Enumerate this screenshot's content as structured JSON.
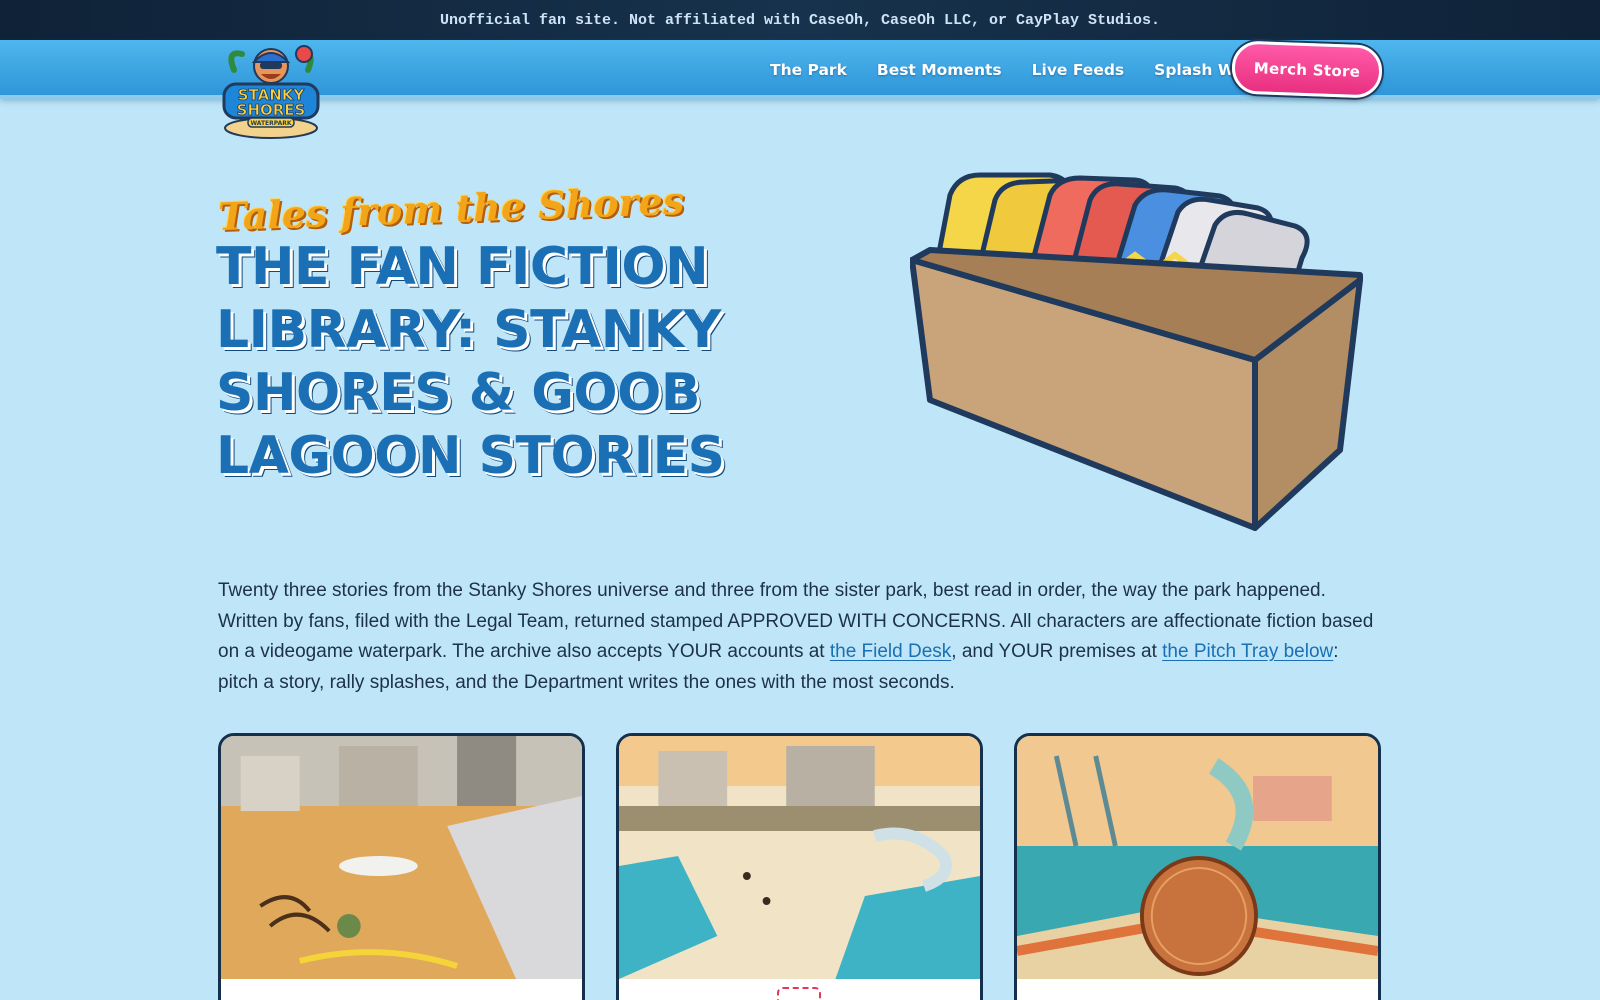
{
  "disclaimer": "Unofficial fan site. Not affiliated with CaseOh, CaseOh LLC, or CayPlay Studios.",
  "logo": {
    "line1": "STANKY",
    "line2": "SHORES",
    "line3": "WATERPARK"
  },
  "nav": {
    "links": [
      "The Park",
      "Best Moments",
      "Live Feeds",
      "Splash Wall"
    ],
    "merch_label": "Merch Store"
  },
  "hero": {
    "kicker": "Tales from the Shores",
    "title": "The Fan Fiction Library: Stanky Shores & Goob Lagoon Stories"
  },
  "intro": {
    "text_before_link1": "Twenty three stories from the Stanky Shores universe and three from the sister park, best read in order, the way the park happened. Written by fans, filed with the Legal Team, returned stamped APPROVED WITH CONCERNS. All characters are affectionate fiction based on a videogame waterpark. The archive also accepts YOUR accounts at ",
    "link1": "the Field Desk",
    "text_between": ", and YOUR premises at ",
    "link2": "the Pitch Tray below",
    "text_after": ": pitch a story, rally splashes, and the Department writes the ones with the most seconds."
  },
  "cards": [
    {
      "image": "sandy-beach-courtyard"
    },
    {
      "image": "beach-pools-waterslides"
    },
    {
      "image": "penny-on-pool-towel"
    }
  ],
  "colors": {
    "background": "#bfe6f8",
    "nav": "#3aa5e2",
    "title": "#1a6fb5",
    "kicker": "#f2a518",
    "merch": "#f0418f",
    "banner": "#14283f"
  }
}
